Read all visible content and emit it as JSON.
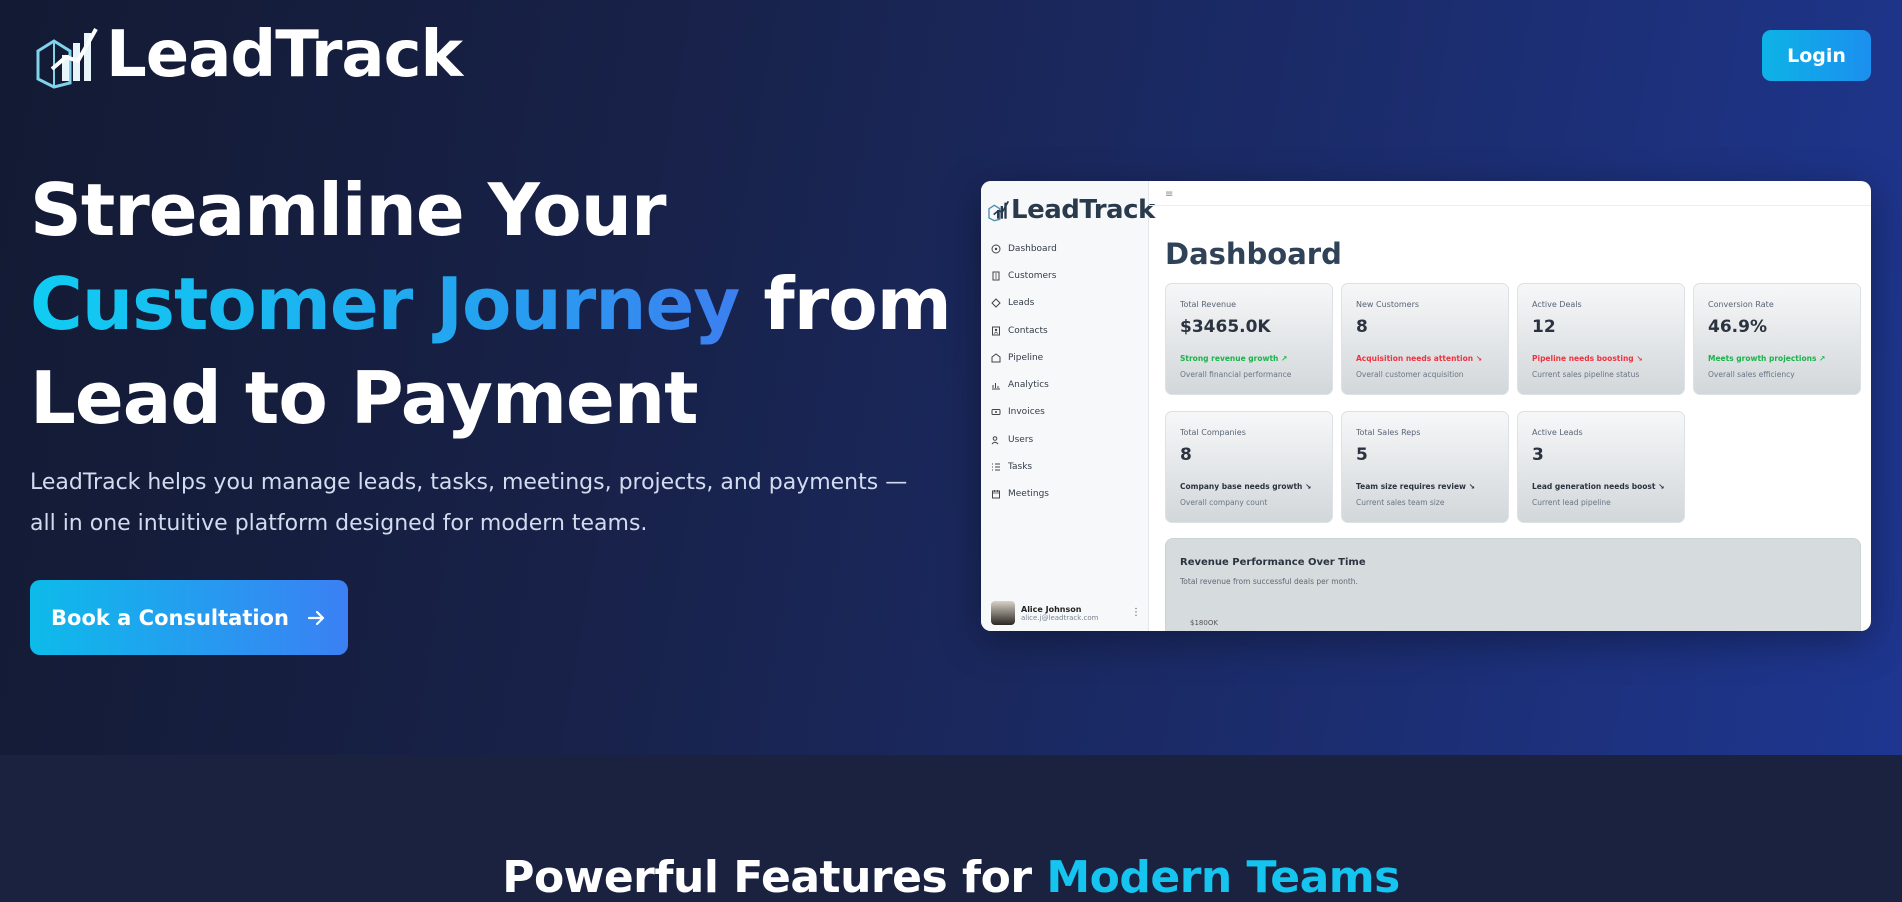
{
  "brand": {
    "name": "LeadTrack"
  },
  "header": {
    "login_label": "Login"
  },
  "hero": {
    "line1": "Streamline Your",
    "line2_accent": "Customer Journey",
    "line2_rest": "from",
    "line3": "Lead to Payment",
    "subtitle_line1": "LeadTrack helps you manage leads, tasks, meetings, projects, and payments —",
    "subtitle_line2": "all in one intuitive platform designed for modern teams.",
    "cta_label": "Book a Consultation"
  },
  "features": {
    "title_main": "Powerful Features for",
    "title_accent": "Modern Teams"
  },
  "colors": {
    "accent": "#10cdf2",
    "cta_start": "#0dbbea",
    "cta_end": "#3b80f4",
    "up": "#19b34a",
    "down": "#ef3340"
  },
  "mockup": {
    "brand": "LeadTrack",
    "nav": [
      {
        "label": "Dashboard",
        "icon": "dashboard-icon"
      },
      {
        "label": "Customers",
        "icon": "building-icon"
      },
      {
        "label": "Leads",
        "icon": "diamond-icon"
      },
      {
        "label": "Contacts",
        "icon": "contact-icon"
      },
      {
        "label": "Pipeline",
        "icon": "pipeline-icon"
      },
      {
        "label": "Analytics",
        "icon": "analytics-icon"
      },
      {
        "label": "Invoices",
        "icon": "invoice-icon"
      },
      {
        "label": "Users",
        "icon": "users-icon"
      },
      {
        "label": "Tasks",
        "icon": "tasks-icon"
      },
      {
        "label": "Meetings",
        "icon": "calendar-icon"
      }
    ],
    "user": {
      "name": "Alice Johnson",
      "email": "alice.j@leadtrack.com"
    },
    "menu_glyph": "≡",
    "title": "Dashboard",
    "cards": [
      {
        "label": "Total Revenue",
        "value": "$3465.0K",
        "trend": "Strong revenue growth",
        "dir": "up",
        "foot": "Overall financial performance"
      },
      {
        "label": "New Customers",
        "value": "8",
        "trend": "Acquisition needs attention",
        "dir": "down",
        "foot": "Overall customer acquisition"
      },
      {
        "label": "Active Deals",
        "value": "12",
        "trend": "Pipeline needs boosting",
        "dir": "down",
        "foot": "Current sales pipeline status"
      },
      {
        "label": "Conversion Rate",
        "value": "46.9%",
        "trend": "Meets growth projections",
        "dir": "up",
        "foot": "Overall sales efficiency"
      },
      {
        "label": "Total Companies",
        "value": "8",
        "trend": "Company base needs growth",
        "dir": "neutral",
        "foot": "Overall company count"
      },
      {
        "label": "Total Sales Reps",
        "value": "5",
        "trend": "Team size requires review",
        "dir": "neutral",
        "foot": "Current sales team size"
      },
      {
        "label": "Active Leads",
        "value": "3",
        "trend": "Lead generation needs boost",
        "dir": "neutral",
        "foot": "Current lead pipeline"
      }
    ],
    "revenue": {
      "title": "Revenue Performance Over Time",
      "subtitle": "Total revenue from successful deals per month.",
      "first_tick": "$180OK"
    }
  }
}
